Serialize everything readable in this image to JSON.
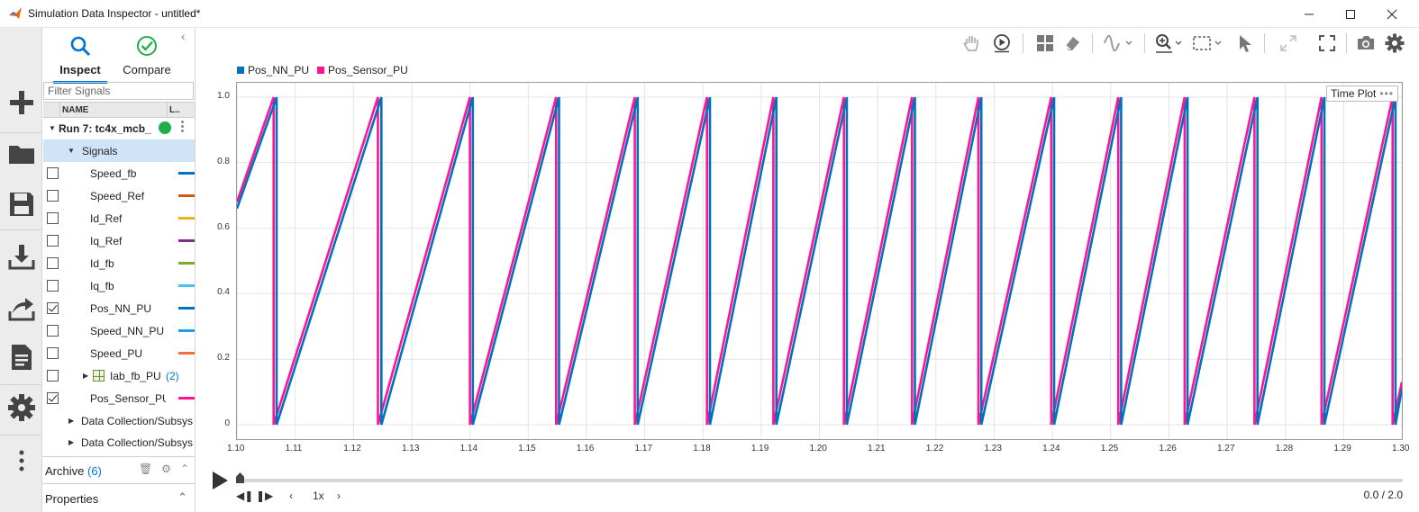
{
  "window": {
    "title": "Simulation Data Inspector - untitled*"
  },
  "tabs": {
    "inspect": "Inspect",
    "compare": "Compare"
  },
  "filter": {
    "placeholder": "Filter Signals"
  },
  "columns": {
    "name": "NAME",
    "line": "L.."
  },
  "run": {
    "label": "Run 7: tc4x_mcb_"
  },
  "signals_group": {
    "label": "Signals"
  },
  "signals": [
    {
      "name": "Speed_fb",
      "checked": false,
      "color": "#0072bd"
    },
    {
      "name": "Speed_Ref",
      "checked": false,
      "color": "#d95319"
    },
    {
      "name": "Id_Ref",
      "checked": false,
      "color": "#edb120"
    },
    {
      "name": "Iq_Ref",
      "checked": false,
      "color": "#7e2f8e"
    },
    {
      "name": "Id_fb",
      "checked": false,
      "color": "#77ac30"
    },
    {
      "name": "Iq_fb",
      "checked": false,
      "color": "#4dbeee"
    },
    {
      "name": "Pos_NN_PU",
      "checked": true,
      "color": "#0072bd"
    },
    {
      "name": "Speed_NN_PU",
      "checked": false,
      "color": "#1e9ce6"
    },
    {
      "name": "Speed_PU",
      "checked": false,
      "color": "#f06e3c"
    },
    {
      "name": "Iab_fb_PU",
      "checked": false,
      "color": "",
      "count": "(2)"
    },
    {
      "name": "Pos_Sensor_PU",
      "checked": true,
      "color": "#ff1493"
    }
  ],
  "groups": [
    "Data Collection/Subsys",
    "Data Collection/Subsys"
  ],
  "archive": {
    "label": "Archive",
    "count": "(6)"
  },
  "properties": {
    "label": "Properties"
  },
  "plot": {
    "badge": "Time Plot"
  },
  "playback": {
    "speed": "1x",
    "time": "0.0 / 2.0"
  },
  "chart_data": {
    "type": "line",
    "xlim": [
      1.1,
      1.3
    ],
    "ylim": [
      0,
      1.0
    ],
    "x_ticks": [
      "1.10",
      "1.11",
      "1.12",
      "1.13",
      "1.14",
      "1.15",
      "1.16",
      "1.17",
      "1.18",
      "1.19",
      "1.20",
      "1.21",
      "1.22",
      "1.23",
      "1.24",
      "1.25",
      "1.26",
      "1.27",
      "1.28",
      "1.29",
      "1.30"
    ],
    "y_ticks": [
      "0",
      "0.2",
      "0.4",
      "0.6",
      "0.8",
      "1.0"
    ],
    "grid": true,
    "legend_placement": "top-left",
    "series": [
      {
        "name": "Pos_NN_PU",
        "color": "#0072bd",
        "shape": "sawtooth",
        "points": [
          [
            1.1,
            0.66
          ],
          [
            1.1068,
            1.0
          ],
          [
            1.1068,
            0.0
          ],
          [
            1.1248,
            1.0
          ],
          [
            1.1248,
            0.0
          ],
          [
            1.1405,
            1.0
          ],
          [
            1.1405,
            0.0
          ],
          [
            1.1553,
            1.0
          ],
          [
            1.1553,
            0.0
          ],
          [
            1.1688,
            1.0
          ],
          [
            1.1688,
            0.0
          ],
          [
            1.1812,
            1.0
          ],
          [
            1.1812,
            0.0
          ],
          [
            1.1926,
            1.0
          ],
          [
            1.1926,
            0.0
          ],
          [
            1.2047,
            1.0
          ],
          [
            1.2047,
            0.0
          ],
          [
            1.2164,
            1.0
          ],
          [
            1.2164,
            0.0
          ],
          [
            1.2278,
            1.0
          ],
          [
            1.2278,
            0.0
          ],
          [
            1.2403,
            1.0
          ],
          [
            1.2403,
            0.0
          ],
          [
            1.2518,
            1.0
          ],
          [
            1.2518,
            0.0
          ],
          [
            1.2632,
            1.0
          ],
          [
            1.2632,
            0.0
          ],
          [
            1.2752,
            1.0
          ],
          [
            1.2752,
            0.0
          ],
          [
            1.2867,
            1.0
          ],
          [
            1.2867,
            0.0
          ],
          [
            1.2989,
            1.0
          ],
          [
            1.2989,
            0.0
          ],
          [
            1.3,
            0.11
          ]
        ]
      },
      {
        "name": "Pos_Sensor_PU",
        "color": "#ff1493",
        "shape": "sawtooth",
        "points": [
          [
            1.1,
            0.68
          ],
          [
            1.1063,
            1.0
          ],
          [
            1.1063,
            0.0
          ],
          [
            1.1242,
            1.0
          ],
          [
            1.1242,
            0.0
          ],
          [
            1.14,
            1.0
          ],
          [
            1.14,
            0.0
          ],
          [
            1.1548,
            1.0
          ],
          [
            1.1548,
            0.0
          ],
          [
            1.1683,
            1.0
          ],
          [
            1.1683,
            0.0
          ],
          [
            1.1807,
            1.0
          ],
          [
            1.1807,
            0.0
          ],
          [
            1.1921,
            1.0
          ],
          [
            1.1921,
            0.0
          ],
          [
            1.2042,
            1.0
          ],
          [
            1.2042,
            0.0
          ],
          [
            1.2159,
            1.0
          ],
          [
            1.2159,
            0.0
          ],
          [
            1.2273,
            1.0
          ],
          [
            1.2273,
            0.0
          ],
          [
            1.2398,
            1.0
          ],
          [
            1.2398,
            0.0
          ],
          [
            1.2513,
            1.0
          ],
          [
            1.2513,
            0.0
          ],
          [
            1.2627,
            1.0
          ],
          [
            1.2627,
            0.0
          ],
          [
            1.2747,
            1.0
          ],
          [
            1.2747,
            0.0
          ],
          [
            1.2862,
            1.0
          ],
          [
            1.2862,
            0.0
          ],
          [
            1.2984,
            1.0
          ],
          [
            1.2984,
            0.0
          ],
          [
            1.3,
            0.13
          ]
        ]
      }
    ]
  }
}
